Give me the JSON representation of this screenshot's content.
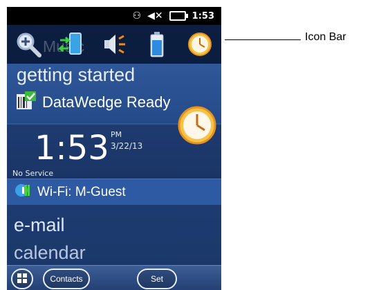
{
  "status_bar": {
    "icons": [
      "sync-icon",
      "speaker-muted-icon",
      "battery-icon"
    ],
    "time": "1:53"
  },
  "icon_bar": {
    "ghost_text": "Music",
    "icons": [
      "magnifier-icon",
      "phone-sync-icon",
      "volume-icon",
      "battery-icon",
      "clock-icon"
    ]
  },
  "tiles": {
    "getting_started": "getting started",
    "datawedge": "DataWedge Ready",
    "clock": {
      "time": "1:53",
      "ampm": "PM",
      "date": "3/22/13",
      "service": "No Service"
    },
    "wifi": "Wi-Fi: M-Guest"
  },
  "menu": {
    "email": "e-mail",
    "calendar": "calendar"
  },
  "app_bar": {
    "contacts": "Contacts",
    "set": "Set"
  },
  "callout": {
    "label": "Icon Bar"
  }
}
